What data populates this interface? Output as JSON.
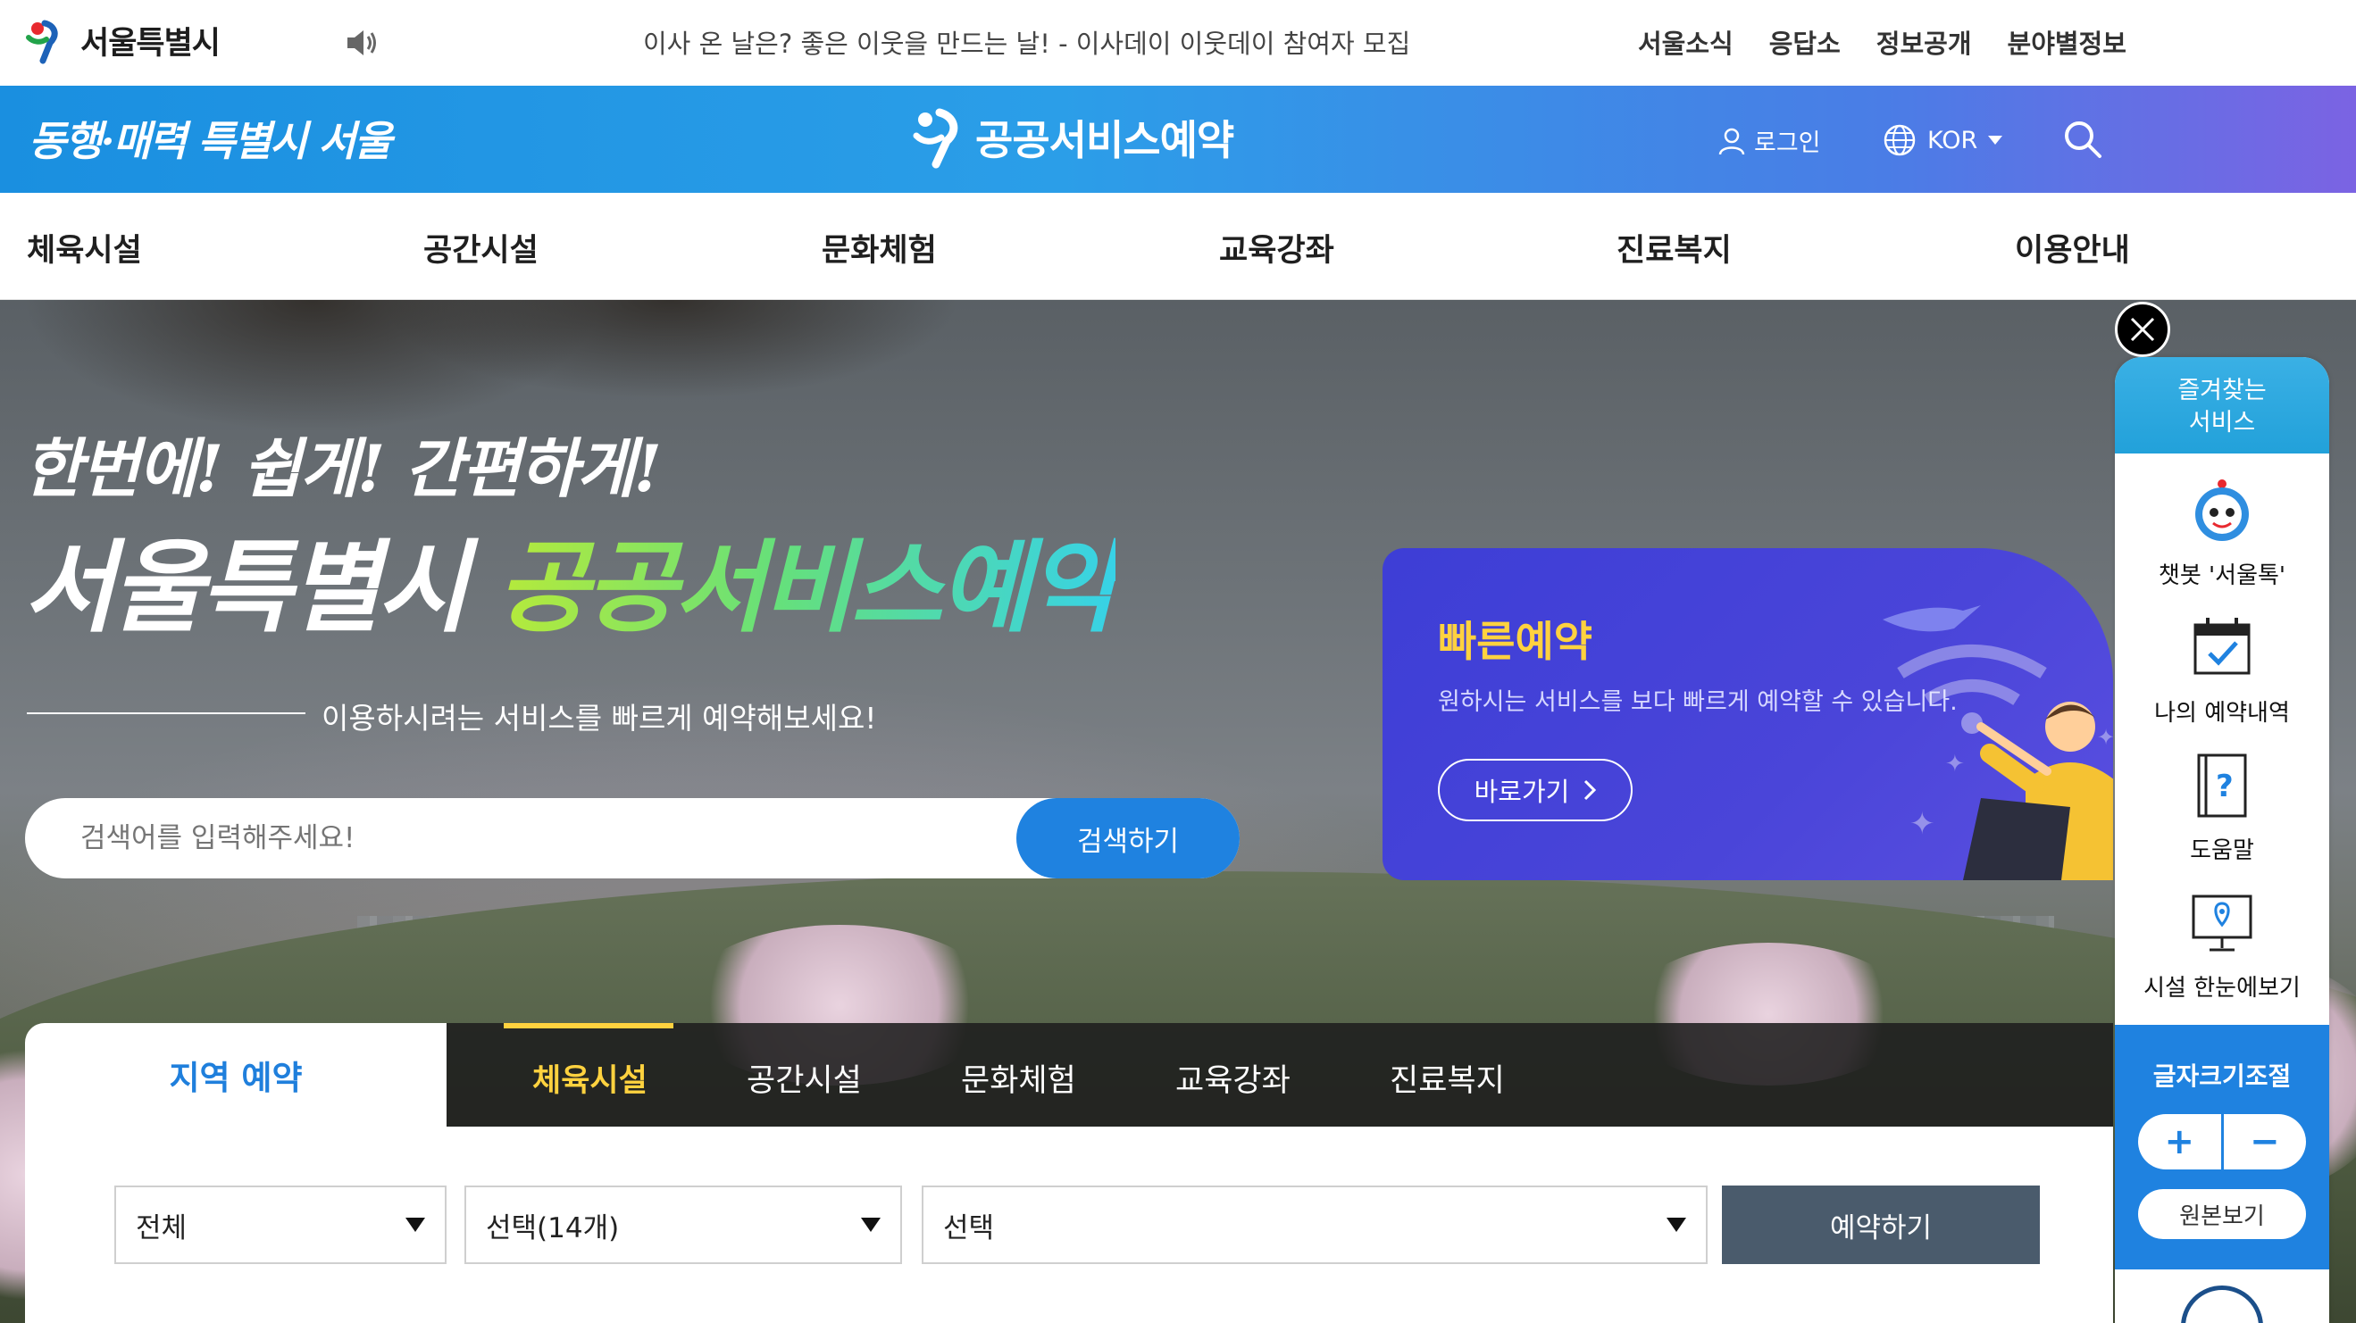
{
  "topbar": {
    "logo_text": "서울특별시",
    "notice": "이사 온 날은? 좋은 이웃을 만드는 날! - 이사데이 이웃데이 참여자 모집",
    "links": [
      "서울소식",
      "응답소",
      "정보공개",
      "분야별정보"
    ]
  },
  "header": {
    "slogan": "동행·매력 특별시 서울",
    "service_name": "공공서비스예약",
    "login_label": "로그인",
    "language": "KOR",
    "search_icon": "search-icon",
    "gradient_colors": [
      "#1a8fe0",
      "#7b63e3"
    ]
  },
  "nav": {
    "items": [
      "체육시설",
      "공간시설",
      "문화체험",
      "교육강좌",
      "진료복지",
      "이용안내"
    ]
  },
  "hero": {
    "line1": "한번에! 쉽게! 간편하게!",
    "line2_white": "서울특별시",
    "line2_green": "공공서비스예약",
    "subtitle": "이용하시려는 서비스를 빠르게 예약해보세요!",
    "search_placeholder": "검색어를 입력해주세요!",
    "search_button": "검색하기"
  },
  "quick_reservation": {
    "title": "빠른예약",
    "description": "원하시는 서비스를 보다 빠르게 예약할 수 있습니다.",
    "button": "바로가기"
  },
  "region_reservation": {
    "tab_label": "지역 예약",
    "categories": [
      "체육시설",
      "공간시설",
      "문화체험",
      "교육강좌",
      "진료복지"
    ],
    "active_category": "체육시설",
    "select_region": "전체",
    "select_facility": "선택(14개)",
    "select_item": "선택",
    "reserve_button": "예약하기"
  },
  "side_panel": {
    "title_line1": "즐겨찾는",
    "title_line2": "서비스",
    "services": [
      {
        "label": "챗봇 '서울톡'",
        "icon": "chatbot-icon"
      },
      {
        "label": "나의 예약내역",
        "icon": "calendar-check-icon"
      },
      {
        "label": "도움말",
        "icon": "help-book-icon"
      },
      {
        "label": "시설 한눈에보기",
        "icon": "map-monitor-icon"
      }
    ],
    "font_size_label": "글자크기조절",
    "plus": "+",
    "minus": "−",
    "original_label": "원본보기"
  },
  "colors": {
    "accent_blue": "#1f82e0",
    "highlight_yellow": "#ffd23f",
    "quick_card_purple": "#4a45d9"
  }
}
